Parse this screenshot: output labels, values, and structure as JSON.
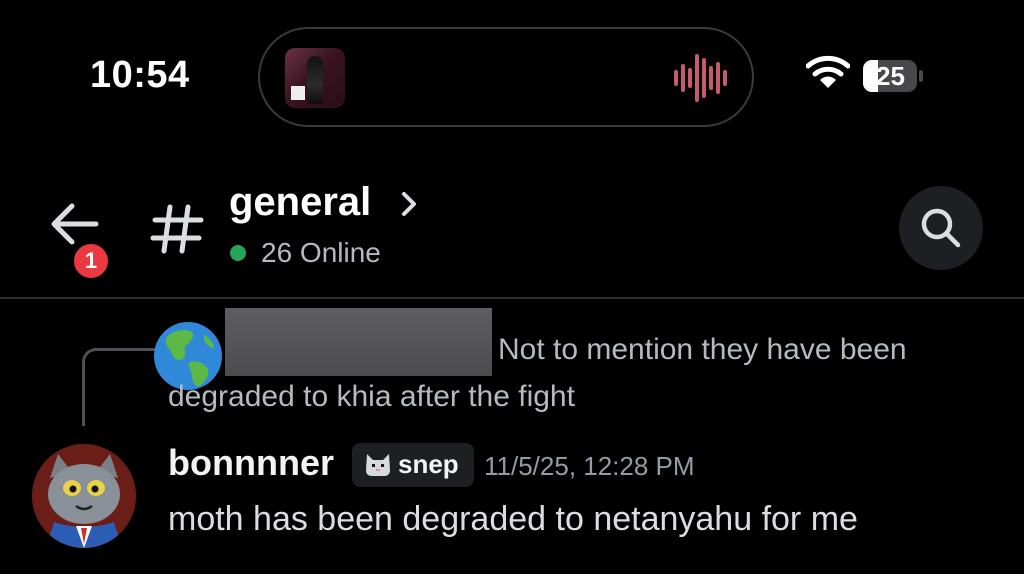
{
  "status_bar": {
    "time": "10:54",
    "battery": "25",
    "wifi_icon": "wifi-icon",
    "now_playing_icon": "album-art",
    "waveform_color": "#c75a6b"
  },
  "header": {
    "back_icon": "arrow-left-icon",
    "notification_count": "1",
    "channel_icon": "hash-icon",
    "channel_name": "general",
    "chevron": "›",
    "online_text": "26 Online",
    "online_color": "#23a55a",
    "search_icon": "search-icon"
  },
  "reply": {
    "avatar_icon": "globe-americas-emoji",
    "text_line1": "Not to mention they have been",
    "text_line2": "degraded to khia after the fight"
  },
  "message": {
    "username": "bonnnner",
    "clan_tag": "snep",
    "clan_icon": "cat-icon",
    "timestamp": "11/5/25, 12:28 PM",
    "text": "moth has been degraded to netanyahu for me"
  }
}
